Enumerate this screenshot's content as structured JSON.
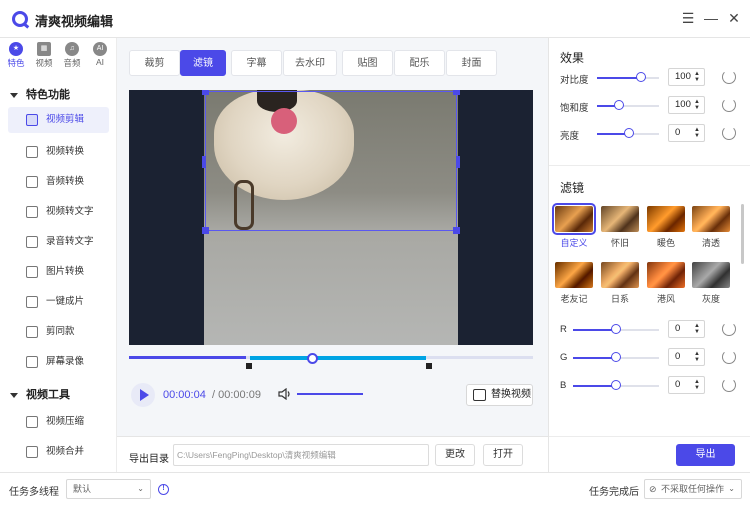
{
  "app": {
    "title": "清爽视频编辑"
  },
  "window_controls": {
    "menu": "☰",
    "minimize": "—",
    "close": "✕"
  },
  "categories": [
    {
      "label": "特色",
      "icon": "star-icon",
      "selected": true
    },
    {
      "label": "视频",
      "icon": "film-icon"
    },
    {
      "label": "音频",
      "icon": "music-icon"
    },
    {
      "label": "AI",
      "icon": "ai-icon",
      "glyph": "AI"
    }
  ],
  "sidebar": {
    "section1": "特色功能",
    "items1": [
      {
        "label": "视频剪辑",
        "selected": true
      },
      {
        "label": "视频转换"
      },
      {
        "label": "音频转换"
      },
      {
        "label": "视频转文字"
      },
      {
        "label": "录音转文字"
      },
      {
        "label": "图片转换"
      },
      {
        "label": "一键成片"
      },
      {
        "label": "剪同款"
      },
      {
        "label": "屏幕录像"
      }
    ],
    "section2": "视频工具",
    "items2": [
      {
        "label": "视频压缩"
      },
      {
        "label": "视频合并"
      }
    ]
  },
  "tabs": [
    "裁剪",
    "滤镜",
    "字幕",
    "去水印",
    "贴图",
    "配乐",
    "封面"
  ],
  "selected_tab": "滤镜",
  "player": {
    "current_time": "00:00:04",
    "total_time": "/ 00:00:09",
    "replace_label": "替换视频",
    "progress": 0.5
  },
  "output": {
    "label": "导出目录",
    "path": "C:\\Users\\FengPing\\Desktop\\清爽视频编辑",
    "change_label": "更改",
    "open_label": "打开",
    "export_label": "导出"
  },
  "effects": {
    "title": "效果",
    "items": [
      {
        "label": "对比度",
        "value": "100",
        "level": 0.8
      },
      {
        "label": "饱和度",
        "value": "100",
        "level": 0.28
      },
      {
        "label": "亮度",
        "value": "0",
        "level": 0.42
      }
    ]
  },
  "filters": {
    "title": "滤镜",
    "items": [
      {
        "label": "自定义",
        "selected": true
      },
      {
        "label": "怀旧"
      },
      {
        "label": "暖色"
      },
      {
        "label": "清透"
      },
      {
        "label": "老友记"
      },
      {
        "label": "日系"
      },
      {
        "label": "港风"
      },
      {
        "label": "灰度"
      }
    ]
  },
  "rgb": [
    {
      "label": "R",
      "value": "0",
      "level": 0.5
    },
    {
      "label": "G",
      "value": "0",
      "level": 0.5
    },
    {
      "label": "B",
      "value": "0",
      "level": 0.5
    }
  ],
  "status": {
    "threads_label": "任务多线程",
    "threads_value": "默认",
    "after_label": "任务完成后",
    "after_value": "不采取任何操作"
  },
  "colors": {
    "accent": "#4b49e8",
    "timeline_cursor": "#00a4e4"
  }
}
